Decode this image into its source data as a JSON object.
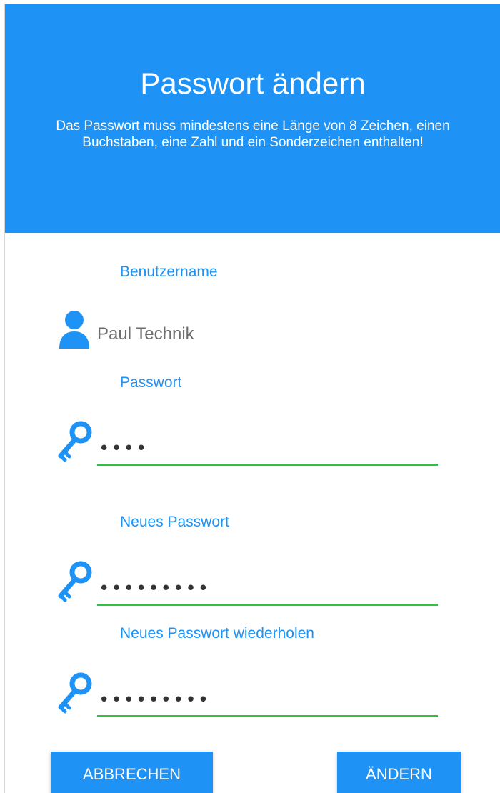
{
  "header": {
    "title": "Passwort ändern",
    "subtitle": "Das Passwort muss mindestens eine Länge von 8 Zeichen, einen Buchstaben, eine Zahl und ein Sonderzeichen enthalten!"
  },
  "fields": {
    "username": {
      "label": "Benutzername",
      "value": "Paul Technik",
      "icon": "user-icon"
    },
    "password": {
      "label": "Passwort",
      "value": "abcd",
      "icon": "key-icon"
    },
    "new_password": {
      "label": "Neues Passwort",
      "value": "abcdefghi",
      "icon": "key-icon"
    },
    "repeat_password": {
      "label": "Neues Passwort wiederholen",
      "value": "abcdefghi",
      "icon": "key-icon"
    }
  },
  "buttons": {
    "cancel": "ABBRECHEN",
    "change": "ÄNDERN"
  },
  "colors": {
    "accent": "#1e93f5",
    "input_underline_valid": "#2ec23f",
    "text_muted": "#6d6d6d"
  }
}
